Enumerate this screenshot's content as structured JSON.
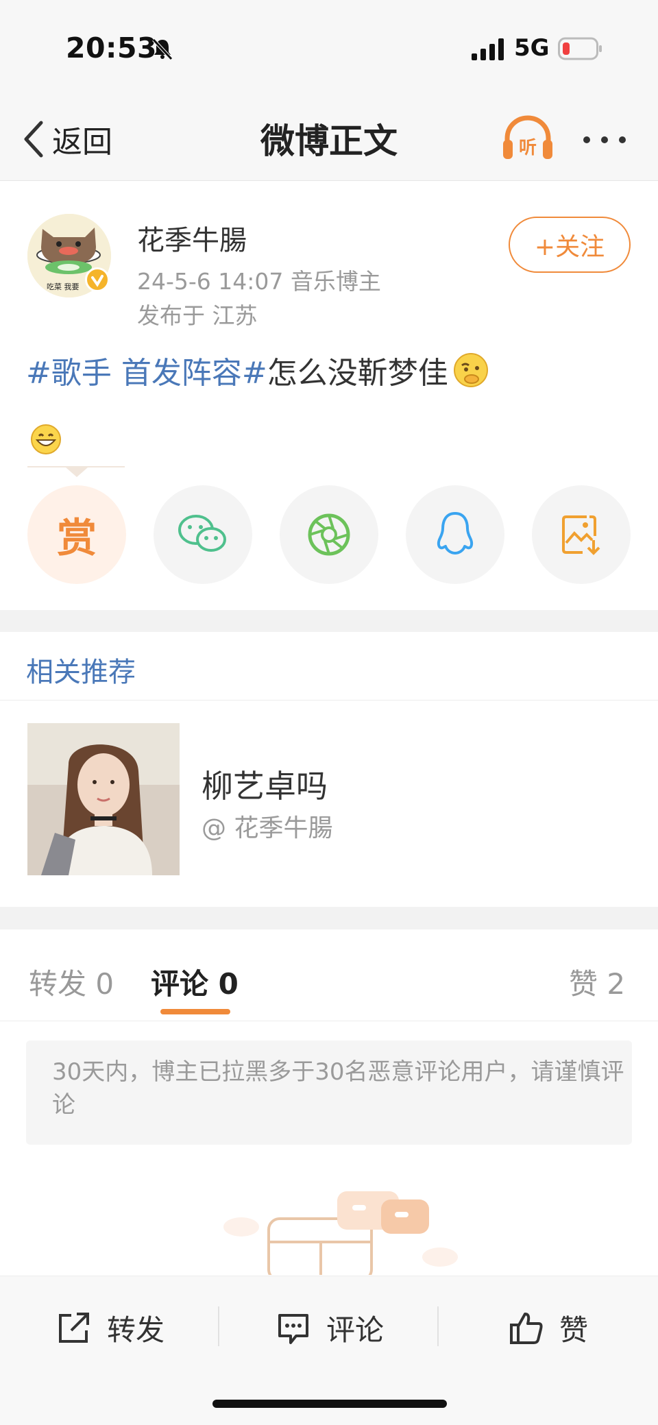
{
  "status_bar": {
    "time": "20:53",
    "network": "5G",
    "icons": [
      "bell-muted-icon",
      "signal-icon",
      "battery-low-icon"
    ],
    "battery_color": "#f04040"
  },
  "nav": {
    "back_label": "返回",
    "title": "微博正文",
    "listen_label": "听",
    "more_icon": "more-dots-icon"
  },
  "post": {
    "author": "花季牛腸",
    "avatar_caption": "吃菜 我要",
    "meta": "24-5-6 14:07  音乐博主",
    "location": "发布于 江苏",
    "follow_label": "+关注",
    "topic": "#歌手 首发阵容#",
    "text": "怎么没靳梦佳",
    "emojis": [
      "thinking-emoji",
      "grin-emoji"
    ]
  },
  "share": {
    "reward_label": "赏",
    "items": [
      "reward",
      "wechat-icon",
      "moments-icon",
      "qq-icon",
      "save-image-icon"
    ]
  },
  "related": {
    "title": "相关推荐",
    "item_name": "柳艺卓吗",
    "item_user": "@ 花季牛腸"
  },
  "tabs": {
    "repost": "转发 0",
    "comment": "评论 0",
    "like": "赞 2"
  },
  "notice": "30天内，博主已拉黑多于30名恶意评论用户，请谨慎评论",
  "bottom_bar": {
    "repost": "转发",
    "comment": "评论",
    "like": "赞"
  },
  "colors": {
    "accent": "#f08a3a",
    "link": "#4a78b8",
    "muted": "#9a9a9a"
  }
}
